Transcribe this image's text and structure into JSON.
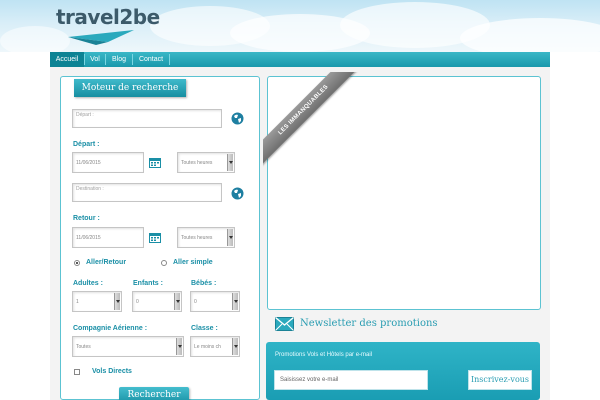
{
  "brand": {
    "logo_text": "travel2be"
  },
  "nav": {
    "items": [
      "Accueil",
      "Vol",
      "Blog",
      "Contact"
    ]
  },
  "search": {
    "tab_label": "Moteur de recherche",
    "depart_placeholder": "Départ     :",
    "depart_label": "Départ :",
    "depart_date": "11/06/2015",
    "depart_time": "Toutes heures",
    "destination_placeholder": "Destination     :",
    "retour_label": "Retour :",
    "retour_date": "11/06/2015",
    "retour_time": "Toutes heures",
    "trip_roundtrip": "Aller/Retour",
    "trip_oneway": "Aller simple",
    "trip_selected": "roundtrip",
    "adults_label": "Adultes :",
    "adults_value": "1",
    "children_label": "Enfants :",
    "children_value": "0",
    "babies_label": "Bébés :",
    "babies_value": "0",
    "airline_label": "Compagnie Aérienne :",
    "airline_value": "Toutes",
    "class_label": "Classe :",
    "class_value": "Le moins ch",
    "direct_label": "Vols Directs",
    "submit_label": "Rechercher"
  },
  "promo": {
    "ribbon_text": "LES IMMANQUABLES"
  },
  "newsletter": {
    "title": "Newsletter des promotions",
    "subtitle": "Promotions Vols et Hôtels par e-mail",
    "email_placeholder": "Saisissez votre e-mail",
    "submit_label": "Inscrivez-vous"
  },
  "colors": {
    "accent": "#1a9db3",
    "accent_dark": "#0d8394",
    "label": "#1a8fa6",
    "ribbon": "#7a7a7a"
  },
  "icons": [
    "paper-plane-icon",
    "globe-icon",
    "calendar-icon",
    "envelope-icon"
  ]
}
